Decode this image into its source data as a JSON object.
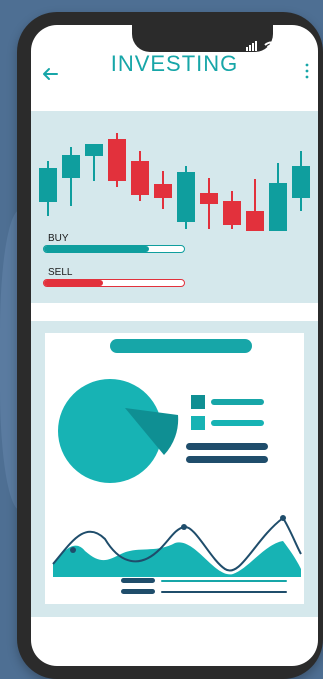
{
  "header": {
    "title": "INVESTING"
  },
  "trade": {
    "buy_label": "BUY",
    "buy_level": 0.75,
    "sell_label": "SELL",
    "sell_level": 0.42
  },
  "colors": {
    "accent": "#17a6a8",
    "teal": "#0f9e9e",
    "navy": "#1f4d6b",
    "red": "#e2313c",
    "panel": "#d5e8ec"
  },
  "icons": {
    "back": "arrow-left",
    "more": "kebab",
    "signal": "signal",
    "wifi": "wifi",
    "battery": "battery"
  }
}
